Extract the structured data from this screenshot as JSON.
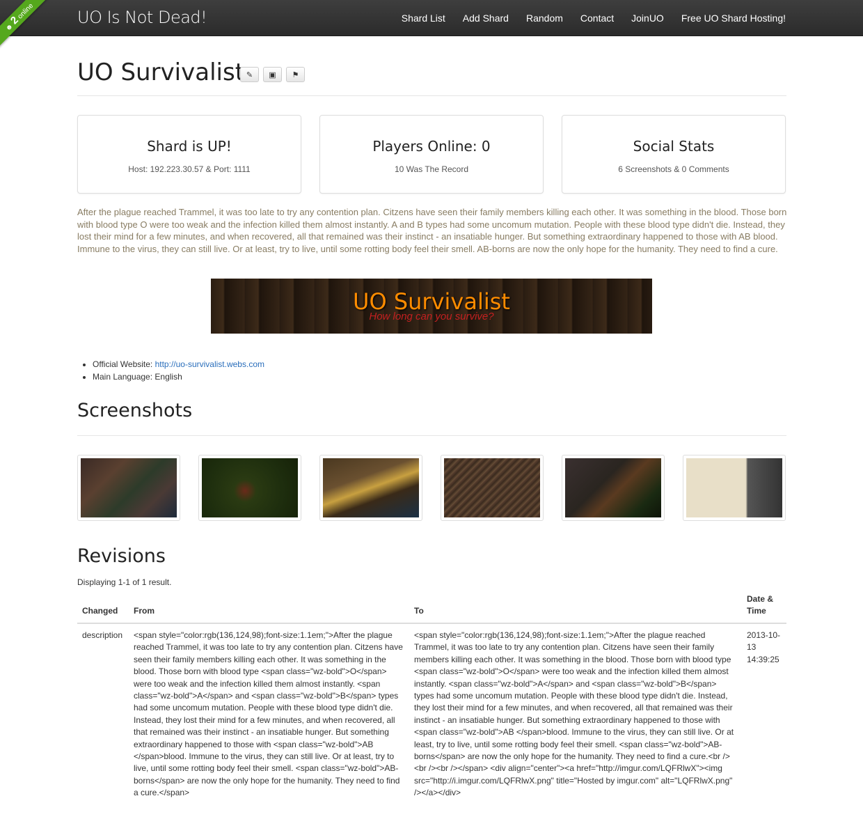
{
  "ribbon": {
    "count": "2",
    "label": "online"
  },
  "navbar": {
    "brand": "UO Is Not Dead!",
    "links": [
      "Shard List",
      "Add Shard",
      "Random",
      "Contact",
      "JoinUO",
      "Free UO Shard Hosting!"
    ]
  },
  "page": {
    "title": "UO Survivalist",
    "title_buttons": [
      "pencil-icon",
      "picture-icon",
      "flag-icon"
    ]
  },
  "stats": [
    {
      "heading": "Shard is UP!",
      "detail": "Host: 192.223.30.57 & Port: 1111"
    },
    {
      "heading": "Players Online: 0",
      "detail": "10 Was The Record"
    },
    {
      "heading": "Social Stats",
      "detail": "6 Screenshots & 0 Comments"
    }
  ],
  "description": "After the plague reached Trammel, it was too late to try any contention plan. Citzens have seen their family members killing each other. It was something in the blood. Those born with blood type O were too weak and the infection killed them almost instantly. A and B types had some uncomum mutation. People with these blood type didn't die. Instead, they lost their mind for a few minutes, and when recovered, all that remained was their instinct - an insatiable hunger. But something extraordinary happened to those with AB blood. Immune to the virus, they can still live. Or at least, try to live, until some rotting body feel their smell. AB-borns are now the only hope for the humanity. They need to find a cure.",
  "description_color": "#887c62",
  "banner": {
    "title": "UO Survivalist",
    "subtitle": "How long can you survive?"
  },
  "info": {
    "website_label": "Official Website: ",
    "website_url": "http://uo-survivalist.webs.com",
    "language": "Main Language: English"
  },
  "screenshots": {
    "heading": "Screenshots"
  },
  "revisions": {
    "heading": "Revisions",
    "summary": "Displaying 1-1 of 1 result.",
    "columns": [
      "Changed",
      "From",
      "To",
      "Date & Time"
    ],
    "rows": [
      {
        "changed": "description",
        "from": "<span style=\"color:rgb(136,124,98);font-size:1.1em;\">After the plague reached Trammel, it was too late to try any contention plan. Citzens have seen their family members killing each other. It was something in the blood. Those born with blood type <span class=\"wz-bold\">O</span> were too weak and the infection killed them almost instantly. <span class=\"wz-bold\">A</span> and <span class=\"wz-bold\">B</span> types had some uncomum mutation. People with these blood type didn't die. Instead, they lost their mind for a few minutes, and when recovered, all that remained was their instinct - an insatiable hunger. But something extraordinary happened to those with <span class=\"wz-bold\">AB </span>blood. Immune to the virus, they can still live. Or at least, try to live, until some rotting body feel their smell. <span class=\"wz-bold\">AB-borns</span> are now the only hope for the humanity. They need to find a cure.</span>",
        "to": "<span style=\"color:rgb(136,124,98);font-size:1.1em;\">After the plague reached Trammel, it was too late to try any contention plan. Citzens have seen their family members killing each other. It was something in the blood. Those born with blood type <span class=\"wz-bold\">O</span> were too weak and the infection killed them almost instantly. <span class=\"wz-bold\">A</span> and <span class=\"wz-bold\">B</span> types had some uncomum mutation. People with these blood type didn't die. Instead, they lost their mind for a few minutes, and when recovered, all that remained was their instinct - an insatiable hunger. But something extraordinary happened to those with <span class=\"wz-bold\">AB </span>blood. Immune to the virus, they can still live. Or at least, try to live, until some rotting body feel their smell. <span class=\"wz-bold\">AB-borns</span> are now the only hope for the humanity. They need to find a cure.<br /><br /><br /></span> <div align=\"center\"><a href=\"http://imgur.com/LQFRlwX\"><img src=\"http://i.imgur.com/LQFRlwX.png\" title=\"Hosted by imgur.com\" alt=\"LQFRlwX.png\" /></a></div>",
        "date": "2013-10-13 14:39:25"
      }
    ]
  }
}
